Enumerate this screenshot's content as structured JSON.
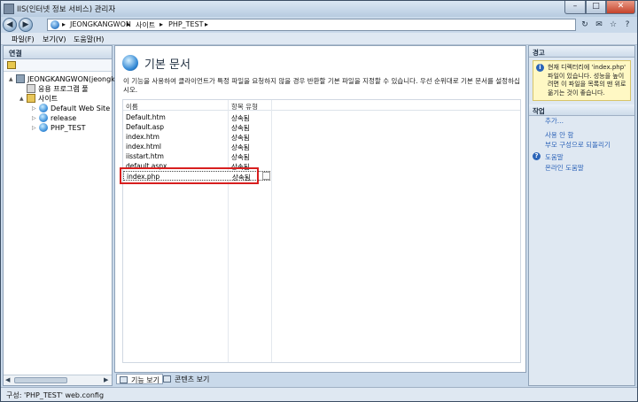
{
  "window": {
    "title": "IIS(인터넷 정보 서비스) 관리자",
    "controls": {
      "minimize": "–",
      "maximize": "□",
      "close": "✕"
    }
  },
  "address": {
    "crumbs": [
      "JEONGKANGWON",
      "사이트",
      "PHP_TEST"
    ],
    "separator": "▸",
    "actions": [
      "↻",
      "✉",
      "☆",
      "?"
    ]
  },
  "menu": [
    "파일(F)",
    "보기(V)",
    "도움말(H)"
  ],
  "connections": {
    "header": "연결",
    "tree": [
      {
        "label": "JEONGKANGWON(jeongkangwon\\...",
        "icon": "server-icon",
        "toggle": "▲"
      },
      {
        "label": "응용 프로그램 풀",
        "icon": "app-pool-icon",
        "toggle": ""
      },
      {
        "label": "사이트",
        "icon": "sites-folder-icon",
        "toggle": "▲"
      },
      {
        "label": "Default Web Site",
        "icon": "site-globe-icon",
        "toggle": "▷"
      },
      {
        "label": "release",
        "icon": "site-globe-icon",
        "toggle": "▷"
      },
      {
        "label": "PHP_TEST",
        "icon": "site-globe-icon",
        "toggle": "▷"
      }
    ]
  },
  "feature": {
    "title": "기본 문서",
    "description": "이 기능을 사용하여 클라이언트가 특정 파일을 요청하지 않을 경우 반환할 기본 파일을 지정할 수 있습니다. 우선 순위대로 기본 문서를 설정하십시오.",
    "columns": [
      "이름",
      "항목 유형"
    ],
    "rows": [
      {
        "name": "Default.htm",
        "type": "상속됨"
      },
      {
        "name": "Default.asp",
        "type": "상속됨"
      },
      {
        "name": "index.htm",
        "type": "상속됨"
      },
      {
        "name": "index.html",
        "type": "상속됨"
      },
      {
        "name": "iisstart.htm",
        "type": "상속됨"
      },
      {
        "name": "default.aspx",
        "type": "상속됨"
      },
      {
        "name": "index.php",
        "type": "상속됨"
      }
    ]
  },
  "view_tabs": [
    "기능 보기",
    "콘텐츠 보기"
  ],
  "alerts": {
    "header": "경고",
    "message": "현재 디렉터리에 'index.php' 파일이 있습니다. 성능을 높이려면 이 파일을 목록의 맨 위로 옮기는 것이 좋습니다."
  },
  "actions": {
    "header": "작업",
    "items": [
      "추가...",
      "사용 안 함",
      "부모 구성으로 되돌리기"
    ],
    "help_items": [
      "도움말",
      "온라인 도움말"
    ]
  },
  "status": "구성: 'PHP_TEST' web.config"
}
